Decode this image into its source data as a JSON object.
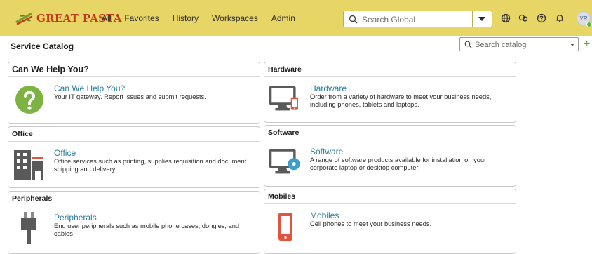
{
  "app": {
    "brand": "GREAT PASTA",
    "menu": [
      "All",
      "Favorites",
      "History",
      "Workspaces",
      "Admin"
    ],
    "global_search_placeholder": "Search Global",
    "avatar_initials": "YR"
  },
  "page": {
    "title": "Service Catalog",
    "catalog_search_placeholder": "Search catalog",
    "add_label": "+"
  },
  "cards": [
    {
      "header": "Can We Help You?",
      "name": "Can We Help You?",
      "description": "Your IT gateway. Report issues and submit requests.",
      "icon": "help-icon"
    },
    {
      "header": "Hardware",
      "name": "Hardware",
      "description": "Order from a variety of hardware to meet your business needs, including phones, tablets and laptops.",
      "icon": "hardware-icon"
    },
    {
      "header": "Office",
      "name": "Office",
      "description": "Office services such as printing, supplies requisition and document shipping and delivery.",
      "icon": "office-icon"
    },
    {
      "header": "Software",
      "name": "Software",
      "description": "A range of software products available for installation on your corporate laptop or desktop computer.",
      "icon": "software-icon"
    },
    {
      "header": "Peripherals",
      "name": "Peripherals",
      "description": "End user peripherals such as mobile phone cases, dongles, and cables",
      "icon": "peripherals-icon"
    },
    {
      "header": "Mobiles",
      "name": "Mobiles",
      "description": "Cell phones to meet your business needs.",
      "icon": "mobile-icon"
    }
  ],
  "colors": {
    "nav_background": "#e7d565",
    "brand": "#c0391b",
    "link": "#2a7d9c",
    "help_green": "#7db342",
    "accent_red": "#e0553d",
    "accent_blue": "#3aa0c8",
    "add_green": "#6aa33a"
  }
}
